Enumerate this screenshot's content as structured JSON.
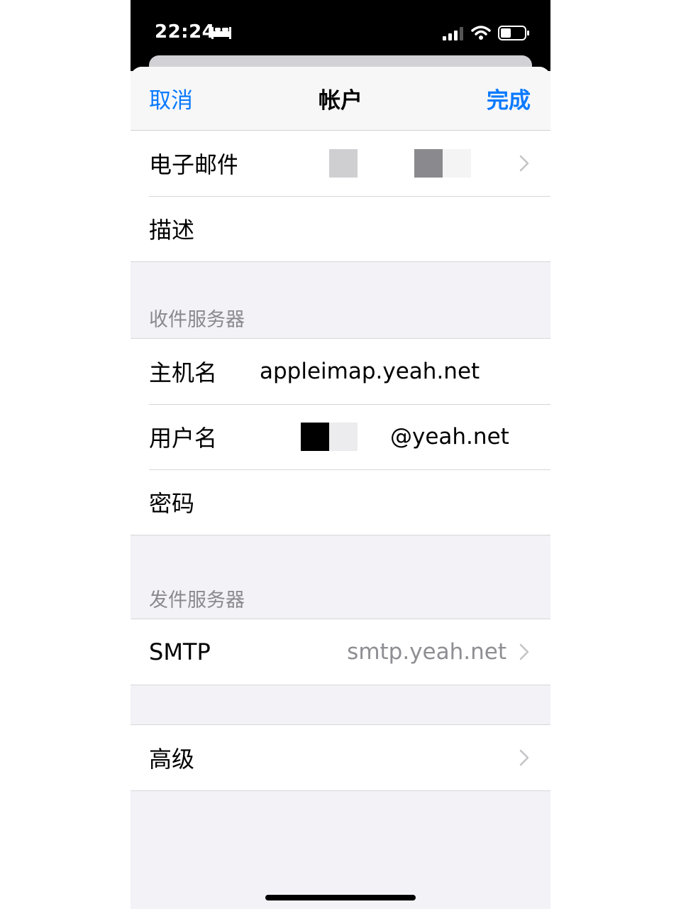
{
  "status": {
    "time": "22:24"
  },
  "nav": {
    "cancel": "取消",
    "title": "帐户",
    "done": "完成"
  },
  "account": {
    "email_label": "电子邮件",
    "description_label": "描述"
  },
  "incoming": {
    "header": "收件服务器",
    "host_label": "主机名",
    "host_value": "appleimap.yeah.net",
    "user_label": "用户名",
    "user_value": "@yeah.net",
    "password_label": "密码"
  },
  "outgoing": {
    "header": "发件服务器",
    "smtp_label": "SMTP",
    "smtp_value": "smtp.yeah.net"
  },
  "advanced": {
    "label": "高级"
  },
  "colors": {
    "accent": "#0a7aff",
    "secondary_text": "#8e8e93",
    "group_bg": "#f2f2f7"
  }
}
